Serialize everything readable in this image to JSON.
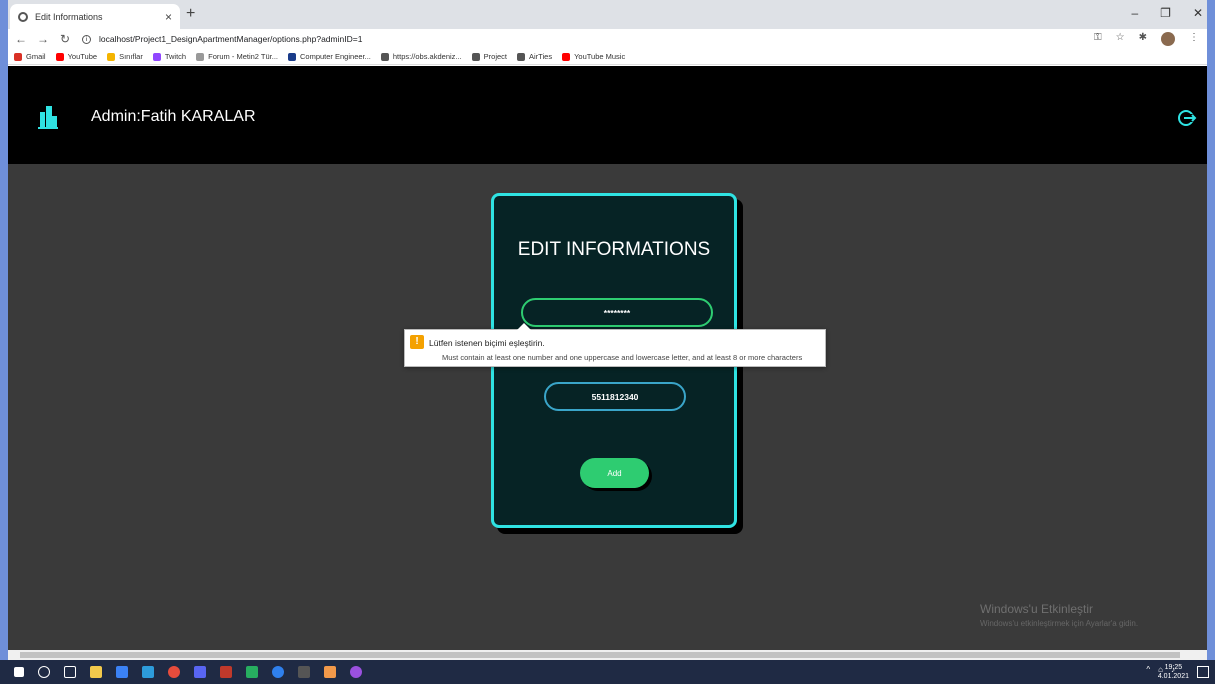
{
  "browser": {
    "tab_title": "Edit Informations",
    "tab_close": "×",
    "new_tab": "+",
    "url": "localhost/Project1_DesignApartmentManager/options.php?adminID=1",
    "bookmarks": [
      {
        "label": "Gmail",
        "color": "#d93025"
      },
      {
        "label": "YouTube",
        "color": "#ff0000"
      },
      {
        "label": "Sınıflar",
        "color": "#f4b400"
      },
      {
        "label": "Twitch",
        "color": "#9146ff"
      },
      {
        "label": "Forum - Metin2 Tür...",
        "color": "#999999"
      },
      {
        "label": "Computer Engineer...",
        "color": "#1a3c8a"
      },
      {
        "label": "https://obs.akdeniz...",
        "color": "#555555"
      },
      {
        "label": "Project",
        "color": "#555555"
      },
      {
        "label": "AirTies",
        "color": "#555555"
      },
      {
        "label": "YouTube Music",
        "color": "#ff0000"
      }
    ]
  },
  "header": {
    "admin_label": "Admin:Fatih KARALAR"
  },
  "card": {
    "title": "EDIT INFORMATIONS",
    "password_value": "********",
    "phone_value": "5511812340",
    "add_label": "Add"
  },
  "tooltip": {
    "message": "Lütfen istenen biçimi eşleştirin.",
    "detail": "Must contain at least one number and one uppercase and lowercase letter, and at least 8 or more characters"
  },
  "watermark": {
    "title": "Windows'u Etkinleştir",
    "subtitle": "Windows'u etkinleştirmek için Ayarlar'a gidin."
  },
  "taskbar": {
    "time": "19:25",
    "date": "4.01.2021"
  },
  "colors": {
    "accent_cyan": "#2fe3e3",
    "green": "#2ecc71",
    "card_bg": "#062325"
  }
}
